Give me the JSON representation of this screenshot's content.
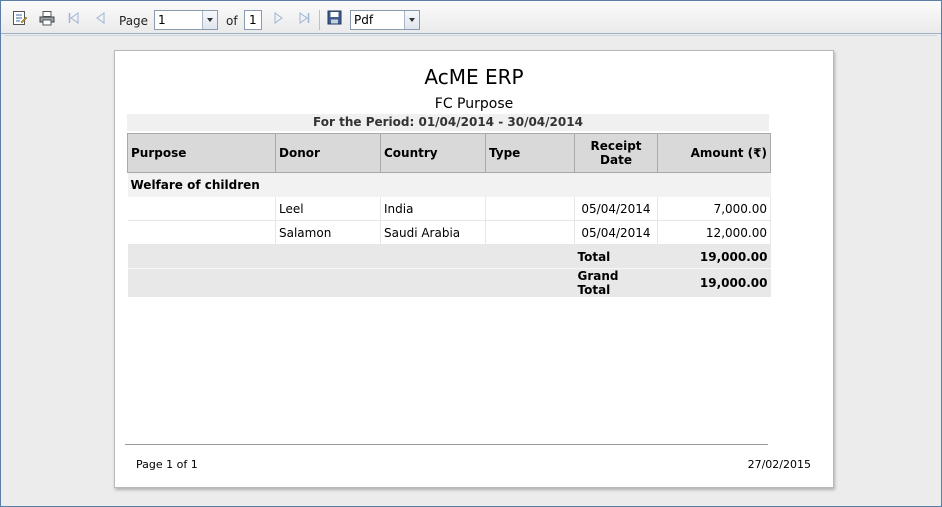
{
  "toolbar": {
    "page_label": "Page",
    "page_value": "1",
    "of_label": "of",
    "total_pages": "1",
    "export_format": "Pdf",
    "icons": [
      "document-map-icon",
      "print-icon",
      "first-page-icon",
      "prev-page-icon",
      "next-page-icon",
      "last-page-icon",
      "save-icon"
    ]
  },
  "report": {
    "title": "AcME ERP",
    "subtitle": "FC Purpose",
    "period": "For the Period: 01/04/2014 - 30/04/2014",
    "columns": [
      "Purpose",
      "Donor",
      "Country",
      "Type",
      "Receipt Date",
      "Amount (₹)"
    ],
    "group": "Welfare of children",
    "rows": [
      {
        "purpose": "",
        "donor": "Leel",
        "country": "India",
        "type": "",
        "date": "05/04/2014",
        "amount": "7,000.00"
      },
      {
        "purpose": "",
        "donor": "Salamon",
        "country": "Saudi Arabia",
        "type": "",
        "date": "05/04/2014",
        "amount": "12,000.00"
      }
    ],
    "total_label": "Total",
    "total_value": "19,000.00",
    "grand_total_label": "Grand Total",
    "grand_total_value": "19,000.00",
    "footer_page": "Page 1 of 1",
    "footer_date": "27/02/2015"
  }
}
